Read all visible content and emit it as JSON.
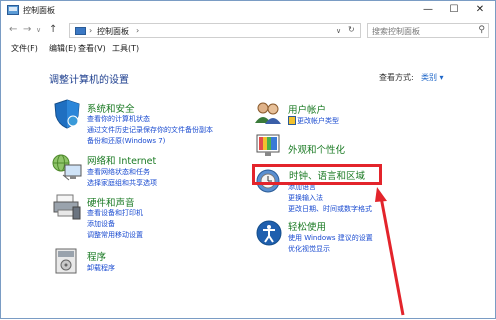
{
  "window": {
    "title": "控制面板"
  },
  "address": {
    "path": "控制面板",
    "search_placeholder": "搜索控制面板"
  },
  "menu": [
    "文件(F)",
    "编辑(E)",
    "查看(V)",
    "工具(T)"
  ],
  "main": {
    "heading": "调整计算机的设置",
    "view_by_label": "查看方式:",
    "view_by_value": "类别 ▾"
  },
  "categories": {
    "system": {
      "title": "系统和安全",
      "links": [
        "查看你的计算机状态",
        "通过文件历史记录保存你的文件备份副本",
        "备份和还原(Windows 7)"
      ]
    },
    "network": {
      "title": "网络和 Internet",
      "links": [
        "查看网络状态和任务",
        "选择家庭组和共享选项"
      ]
    },
    "hardware": {
      "title": "硬件和声音",
      "links": [
        "查看设备和打印机",
        "添加设备",
        "调整常用移动设置"
      ]
    },
    "programs": {
      "title": "程序",
      "links": [
        "卸载程序"
      ]
    },
    "users": {
      "title": "用户帐户",
      "links": [
        "更改帐户类型"
      ]
    },
    "appearance": {
      "title": "外观和个性化",
      "links": []
    },
    "clock": {
      "title": "时钟、语言和区域",
      "links": [
        "添加语言",
        "更换输入法",
        "更改日期、时间或数字格式"
      ]
    },
    "ease": {
      "title": "轻松使用",
      "links": [
        "使用 Windows 建议的设置",
        "优化视觉显示"
      ]
    }
  },
  "colors": {
    "accent": "#1e3f8f",
    "category_green": "#1a7a23",
    "link_blue": "#1a4bd0",
    "highlight_red": "#e3242b"
  }
}
